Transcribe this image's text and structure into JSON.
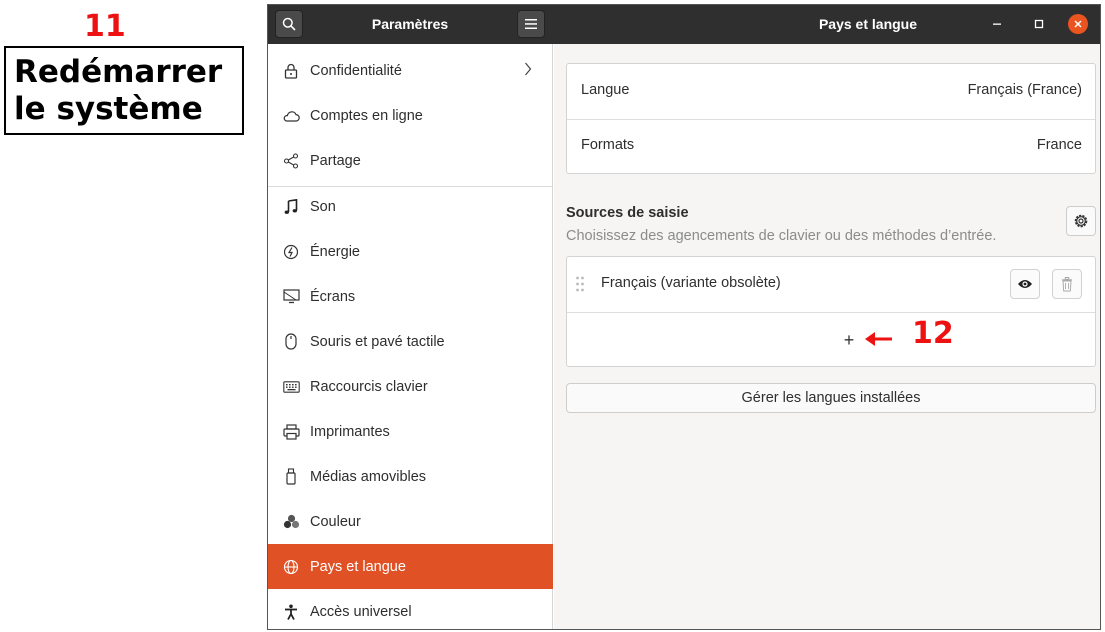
{
  "annotations": {
    "step11": "11",
    "step11_text_line1": "Redémarrer",
    "step11_text_line2": "le système",
    "step12": "12"
  },
  "window": {
    "sidebar_title": "Paramètres",
    "pane_title": "Pays et langue"
  },
  "sidebar": {
    "items": [
      {
        "label": "Confidentialité",
        "icon": "lock-icon"
      },
      {
        "label": "Comptes en ligne",
        "icon": "cloud-icon"
      },
      {
        "label": "Partage",
        "icon": "share-icon"
      },
      {
        "label": "Son",
        "icon": "music-note-icon"
      },
      {
        "label": "Énergie",
        "icon": "power-icon"
      },
      {
        "label": "Écrans",
        "icon": "display-icon"
      },
      {
        "label": "Souris et pavé tactile",
        "icon": "mouse-icon"
      },
      {
        "label": "Raccourcis clavier",
        "icon": "keyboard-icon"
      },
      {
        "label": "Imprimantes",
        "icon": "printer-icon"
      },
      {
        "label": "Médias amovibles",
        "icon": "usb-icon"
      },
      {
        "label": "Couleur",
        "icon": "color-icon"
      },
      {
        "label": "Pays et langue",
        "icon": "globe-icon"
      },
      {
        "label": "Accès universel",
        "icon": "accessibility-icon"
      }
    ],
    "active": "Pays et langue",
    "accent": "#e05226"
  },
  "region": {
    "language_label": "Langue",
    "language_value": "Français (France)",
    "formats_label": "Formats",
    "formats_value": "France"
  },
  "input_sources": {
    "title": "Sources de saisie",
    "subtitle": "Choisissez des agencements de clavier ou des méthodes d’entrée.",
    "sources": [
      {
        "name": "Français (variante obsolète)"
      }
    ],
    "add_label": "+"
  },
  "manage_button": "Gérer les langues installées",
  "colors": {
    "titlebar": "#2f2f2f",
    "close": "#e95420",
    "annotation": "#ee1111"
  }
}
